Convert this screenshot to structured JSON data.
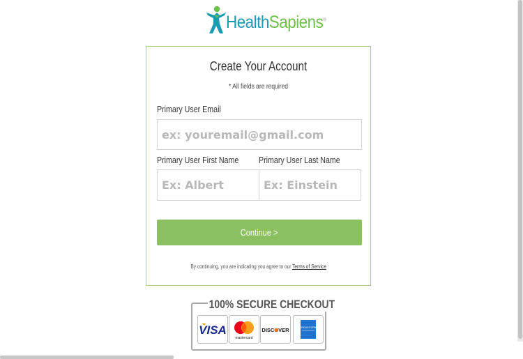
{
  "brand": {
    "name_part1": "Health",
    "name_part2": "Sapiens",
    "trademark": "®"
  },
  "form": {
    "title": "Create Your Account",
    "note": "* All fields are required",
    "email_label": "Primary User Email",
    "email_placeholder": "ex: youremail@gmail.com",
    "first_name_label": "Primary User First Name",
    "first_name_placeholder": "Ex: Albert",
    "last_name_label": "Primary User Last Name",
    "last_name_placeholder": "Ex: Einstein",
    "continue_label": "Continue >",
    "terms_prefix": "By continuing, you are indicating you agree to our ",
    "terms_link": "Terms of Service"
  },
  "secure": {
    "title": "100% SECURE CHECKOUT",
    "cards": [
      "VISA",
      "mastercard",
      "DISCOVER",
      "AMERICAN EXPRESS"
    ]
  },
  "colors": {
    "accent_green": "#8bc061",
    "brand_blue": "#1b9bb3",
    "brand_green": "#6cc04a",
    "card_border": "#a5cf8a"
  },
  "icons": [
    "healthsapiens-person-logo-icon",
    "visa-card-icon",
    "mastercard-card-icon",
    "discover-card-icon",
    "amex-card-icon"
  ]
}
